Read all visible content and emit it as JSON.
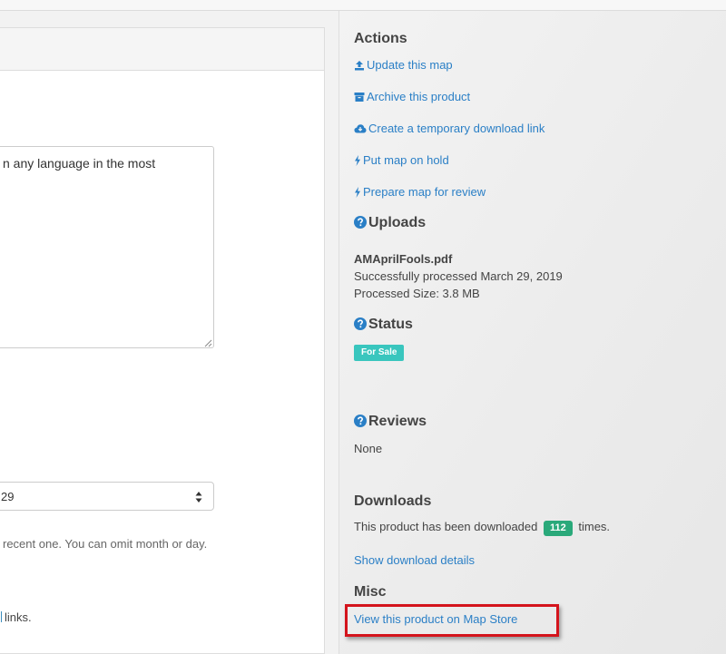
{
  "form": {
    "description_value": "n any language in the most",
    "date_value": "29",
    "date_help": "recent one. You can omit month or day.",
    "links_help": "links."
  },
  "actions": {
    "title": "Actions",
    "update_map": "Update this map",
    "archive_product": "Archive this product",
    "temp_download_link": "Create a temporary download link",
    "put_on_hold": "Put map on hold",
    "prepare_review": "Prepare map for review"
  },
  "uploads": {
    "title": "Uploads",
    "filename": "AMAprilFools.pdf",
    "processed": "Successfully processed March 29, 2019",
    "size": "Processed Size: 3.8 MB"
  },
  "status": {
    "title": "Status",
    "label": "For Sale",
    "label_color": "#39c6be"
  },
  "reviews": {
    "title": "Reviews",
    "value": "None"
  },
  "downloads": {
    "title": "Downloads",
    "text_before": "This product has been downloaded",
    "count": "112",
    "text_after": "times.",
    "details_link": "Show download details",
    "badge_color": "#2aa97a"
  },
  "misc": {
    "title": "Misc",
    "view_on_store": "View this product on Map Store"
  },
  "colors": {
    "link": "#2a7fc6",
    "highlight": "#d4141c"
  }
}
